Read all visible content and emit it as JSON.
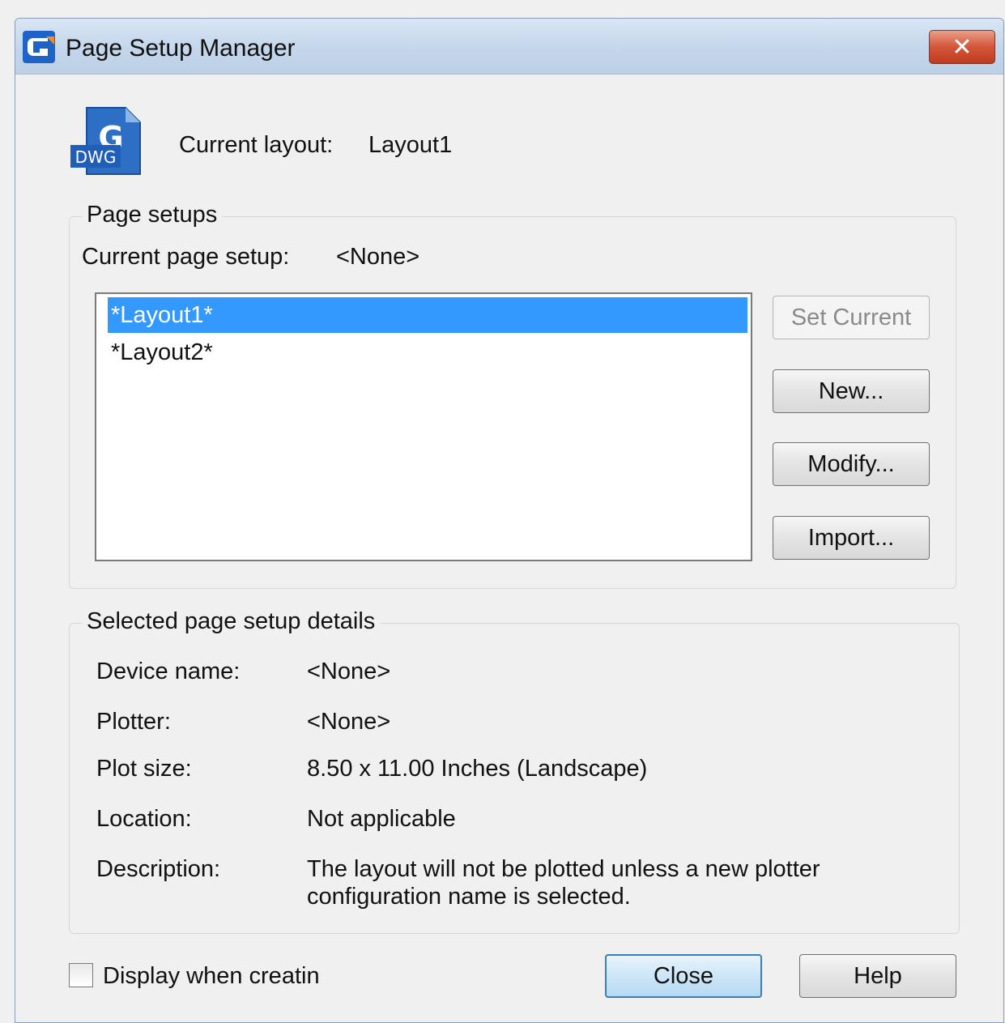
{
  "window": {
    "title": "Page Setup Manager",
    "close_glyph": "✕",
    "app_icon": "app-logo-icon"
  },
  "header": {
    "icon": "dwg-file-icon",
    "icon_text": "DWG",
    "current_layout_label": "Current layout:",
    "current_layout_value": "Layout1"
  },
  "page_setups": {
    "group_title": "Page setups",
    "current_label": "Current page setup:",
    "current_value": "<None>",
    "items": [
      {
        "label": "*Layout1*",
        "selected": true
      },
      {
        "label": "*Layout2*",
        "selected": false
      }
    ],
    "buttons": {
      "set_current": "Set Current",
      "new": "New...",
      "modify": "Modify...",
      "import": "Import..."
    }
  },
  "details": {
    "group_title": "Selected page setup details",
    "rows": [
      {
        "label": "Device name:",
        "value": "<None>"
      },
      {
        "label": "Plotter:",
        "value": "<None>"
      },
      {
        "label": "Plot size:",
        "value": "8.50 x 11.00 Inches (Landscape)"
      },
      {
        "label": "Location:",
        "value": "Not applicable"
      },
      {
        "label": "Description:",
        "value_line1": "The layout will not be plotted unless a new plotter",
        "value_line2": "configuration name is selected."
      }
    ]
  },
  "footer": {
    "checkbox_label": "Display when creatin",
    "checkbox_checked": false,
    "close_label": "Close",
    "help_label": "Help"
  },
  "colors": {
    "selection": "#3399ff",
    "titlebar": "#c2d5ea",
    "close_button": "#d3563a"
  }
}
